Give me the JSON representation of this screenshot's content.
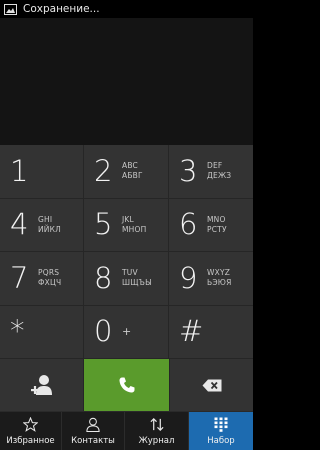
{
  "status_bar": {
    "notification_text": "Сохранение..."
  },
  "keypad": {
    "keys": [
      {
        "digit": "1",
        "latin": "",
        "cyrillic": ""
      },
      {
        "digit": "2",
        "latin": "ABC",
        "cyrillic": "АБВГ"
      },
      {
        "digit": "3",
        "latin": "DEF",
        "cyrillic": "ДЕЖЗ"
      },
      {
        "digit": "4",
        "latin": "GHI",
        "cyrillic": "ИЙКЛ"
      },
      {
        "digit": "5",
        "latin": "JKL",
        "cyrillic": "МНОП"
      },
      {
        "digit": "6",
        "latin": "MNO",
        "cyrillic": "РСТУ"
      },
      {
        "digit": "7",
        "latin": "PQRS",
        "cyrillic": "ФХЦЧ"
      },
      {
        "digit": "8",
        "latin": "TUV",
        "cyrillic": "ШЩЪЫ"
      },
      {
        "digit": "9",
        "latin": "WXYZ",
        "cyrillic": "ЬЭЮЯ"
      },
      {
        "digit": "*",
        "latin": "",
        "cyrillic": ""
      },
      {
        "digit": "0",
        "plus": "+"
      },
      {
        "digit": "#",
        "latin": "",
        "cyrillic": ""
      }
    ]
  },
  "actions": {
    "add_contact_icon": "add-contact-icon",
    "call_icon": "phone-handset-icon",
    "delete_icon": "backspace-icon",
    "call_color": "#5a9b2c"
  },
  "tabs": [
    {
      "label": "Избранное",
      "icon": "star-icon",
      "active": false
    },
    {
      "label": "Контакты",
      "icon": "person-icon",
      "active": false
    },
    {
      "label": "Журнал",
      "icon": "call-log-icon",
      "active": false
    },
    {
      "label": "Набор",
      "icon": "dialpad-icon",
      "active": true
    }
  ],
  "colors": {
    "active_tab": "#1d6bb0",
    "key_bg": "#333333",
    "background": "#000000"
  }
}
